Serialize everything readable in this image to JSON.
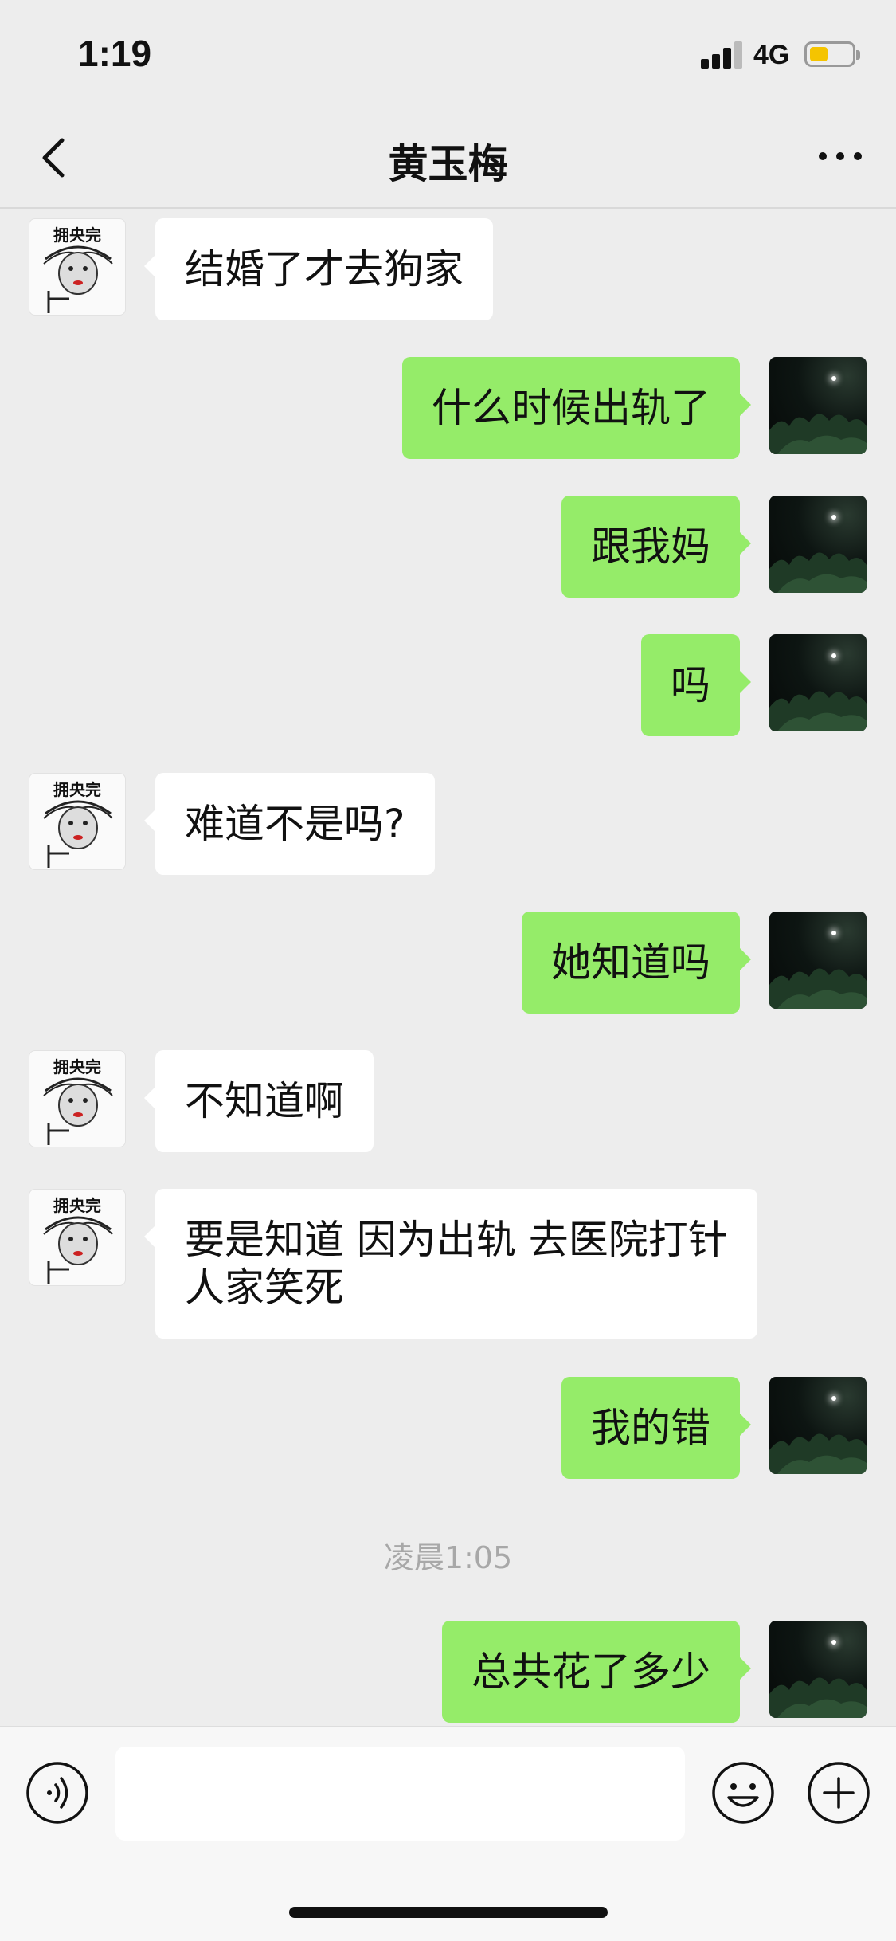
{
  "status_bar": {
    "time": "1:19",
    "network": "4G",
    "battery_level": 0.35,
    "battery_color": "#f5c400"
  },
  "nav": {
    "back_icon": "chevron-left-icon",
    "title": "黄玉梅",
    "more_icon": "more-dots-icon"
  },
  "contact_avatar_caption": "拥央完",
  "messages": [
    {
      "side": "left",
      "text": "结婚了才去狗家"
    },
    {
      "side": "right",
      "text": "什么时候出轨了"
    },
    {
      "side": "right",
      "text": "跟我妈"
    },
    {
      "side": "right",
      "text": "吗"
    },
    {
      "side": "left",
      "text": "难道不是吗?"
    },
    {
      "side": "right",
      "text": "她知道吗"
    },
    {
      "side": "left",
      "text": "不知道啊"
    },
    {
      "side": "left",
      "text": "要是知道 因为出轨 去医院打针\n人家笑死"
    },
    {
      "side": "right",
      "text": "我的错"
    },
    {
      "side": "right",
      "text": "总共花了多少"
    }
  ],
  "timestamp": "凌晨1:05",
  "input_bar": {
    "voice_icon": "voice-icon",
    "input_value": "",
    "emoji_icon": "emoji-icon",
    "plus_icon": "plus-icon"
  },
  "colors": {
    "background": "#ededed",
    "bubble_sent": "#95ec69",
    "bubble_received": "#ffffff",
    "timestamp_text": "#a8a8a8"
  }
}
